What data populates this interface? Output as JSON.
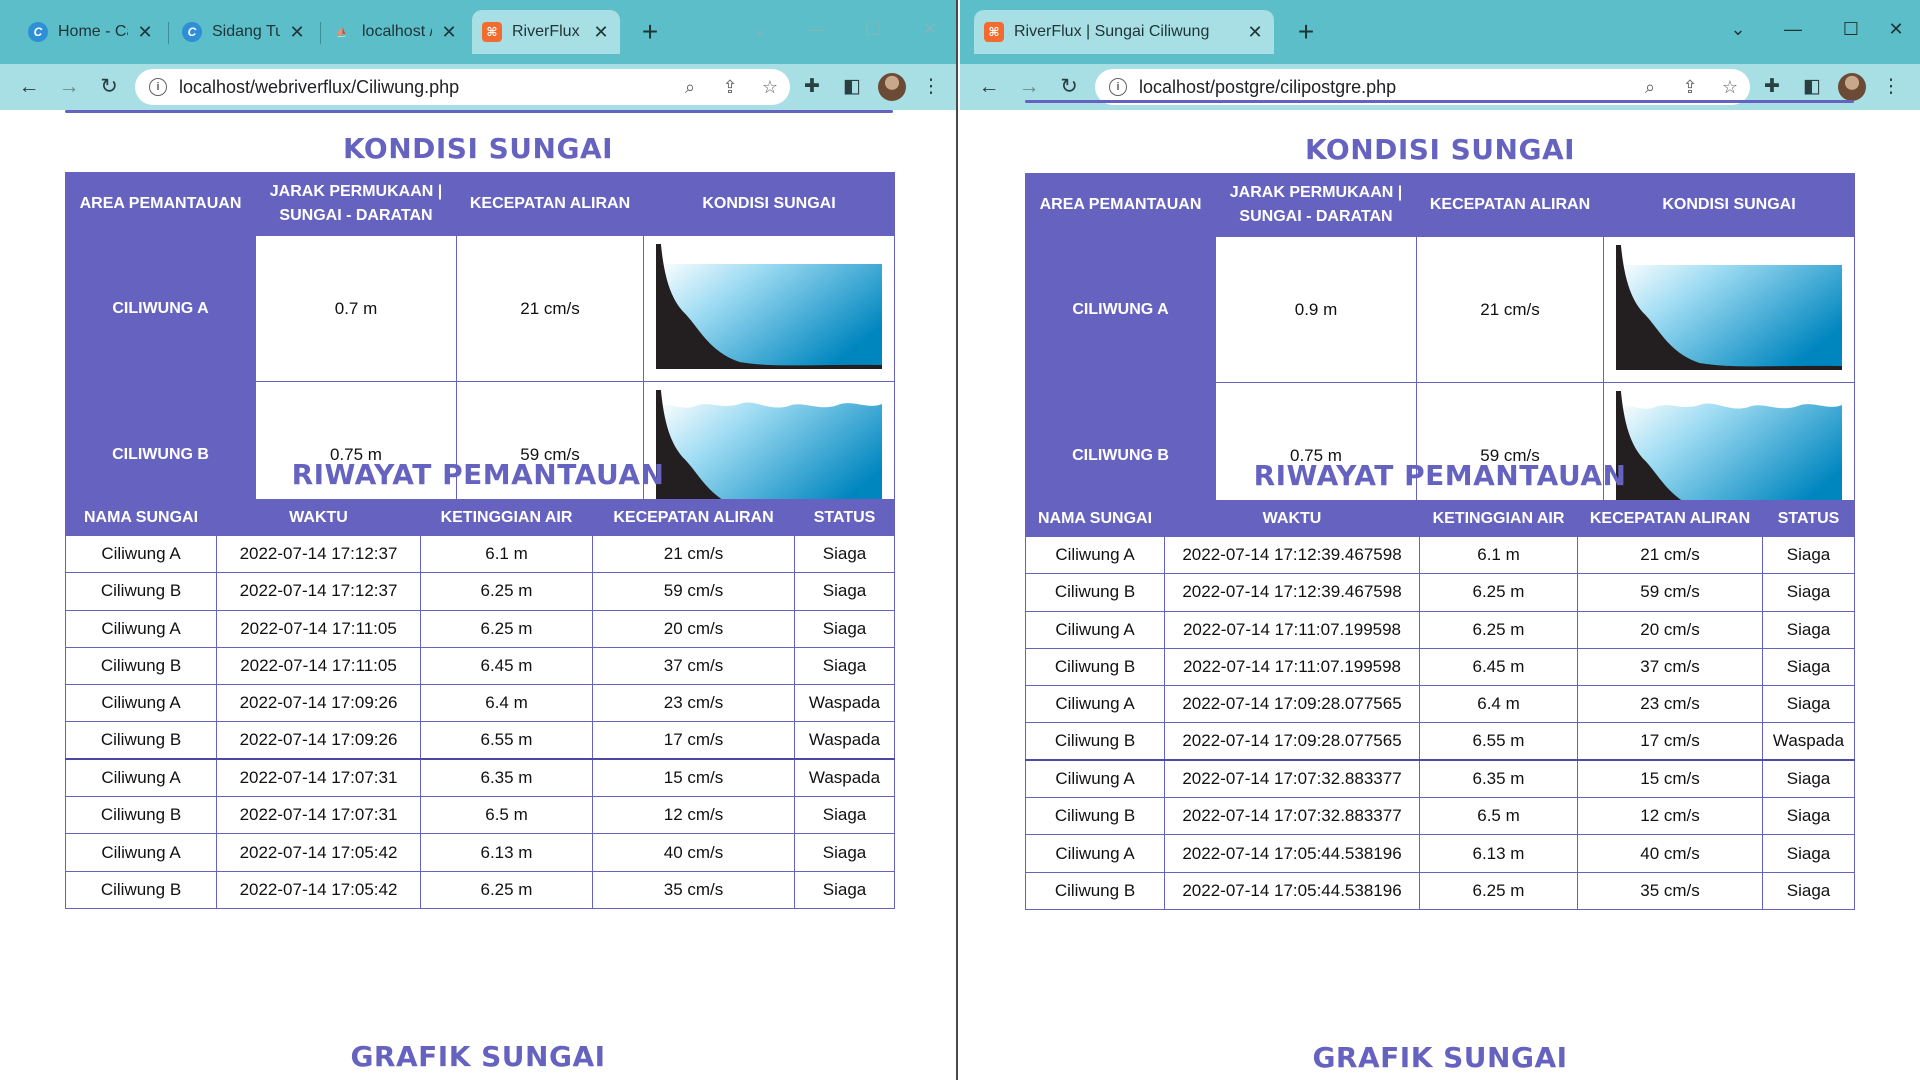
{
  "colors": {
    "accent": "#6563bf",
    "siaga": "#f5a623",
    "waspada": "#e8161b",
    "tab_strip": "#5cbec8",
    "toolbar": "#a7dfe4"
  },
  "left": {
    "tabs": [
      {
        "label": "Home - Ca",
        "icon": "canva-icon"
      },
      {
        "label": "Sidang Tug",
        "icon": "canva-icon"
      },
      {
        "label": "localhost /",
        "icon": "phpmyadmin-icon"
      },
      {
        "label": "RiverFlux |",
        "icon": "xampp-icon"
      }
    ],
    "url": "localhost/webriverflux/Ciliwung.php",
    "kondisi_title": "KONDISI SUNGAI",
    "kondisi_headers": [
      "AREA PEMANTAUAN",
      "JARAK PERMUKAAN | SUNGAI - DARATAN",
      "KECEPATAN ALIRAN",
      "KONDISI SUNGAI"
    ],
    "kondisi_rows": [
      {
        "area": "CILIWUNG A",
        "jarak": "0.7 m",
        "kecepatan": "21 cm/s",
        "kondisi": "calm-water"
      },
      {
        "area": "CILIWUNG B",
        "jarak": "0.75 m",
        "kecepatan": "59 cm/s",
        "kondisi": "wavy-water"
      }
    ],
    "riwayat_title": "RIWAYAT PEMANTAUAN",
    "riwayat_headers": [
      "NAMA SUNGAI",
      "WAKTU",
      "KETINGGIAN AIR",
      "KECEPATAN ALIRAN",
      "STATUS"
    ],
    "riwayat_rows": [
      [
        "Ciliwung A",
        "2022-07-14 17:12:37",
        "6.1 m",
        "21 cm/s",
        "Siaga"
      ],
      [
        "Ciliwung B",
        "2022-07-14 17:12:37",
        "6.25 m",
        "59 cm/s",
        "Siaga"
      ],
      [
        "Ciliwung A",
        "2022-07-14 17:11:05",
        "6.25 m",
        "20 cm/s",
        "Siaga"
      ],
      [
        "Ciliwung B",
        "2022-07-14 17:11:05",
        "6.45 m",
        "37 cm/s",
        "Siaga"
      ],
      [
        "Ciliwung A",
        "2022-07-14 17:09:26",
        "6.4 m",
        "23 cm/s",
        "Waspada"
      ],
      [
        "Ciliwung B",
        "2022-07-14 17:09:26",
        "6.55 m",
        "17 cm/s",
        "Waspada"
      ],
      [
        "Ciliwung A",
        "2022-07-14 17:07:31",
        "6.35 m",
        "15 cm/s",
        "Waspada"
      ],
      [
        "Ciliwung B",
        "2022-07-14 17:07:31",
        "6.5 m",
        "12 cm/s",
        "Siaga"
      ],
      [
        "Ciliwung A",
        "2022-07-14 17:05:42",
        "6.13 m",
        "40 cm/s",
        "Siaga"
      ],
      [
        "Ciliwung B",
        "2022-07-14 17:05:42",
        "6.25 m",
        "35 cm/s",
        "Siaga"
      ]
    ],
    "grafik_title": "GRAFIK SUNGAI"
  },
  "right": {
    "tabs": [
      {
        "label": "RiverFlux | Sungai Ciliwung",
        "icon": "xampp-icon"
      }
    ],
    "url": "localhost/postgre/cilipostgre.php",
    "kondisi_title": "KONDISI SUNGAI",
    "kondisi_headers": [
      "AREA PEMANTAUAN",
      "JARAK PERMUKAAN | SUNGAI - DARATAN",
      "KECEPATAN ALIRAN",
      "KONDISI SUNGAI"
    ],
    "kondisi_rows": [
      {
        "area": "CILIWUNG A",
        "jarak": "0.9 m",
        "kecepatan": "21 cm/s",
        "kondisi": "calm-water"
      },
      {
        "area": "CILIWUNG B",
        "jarak": "0.75 m",
        "kecepatan": "59 cm/s",
        "kondisi": "wavy-water"
      }
    ],
    "riwayat_title": "RIWAYAT PEMANTAUAN",
    "riwayat_headers": [
      "NAMA SUNGAI",
      "WAKTU",
      "KETINGGIAN AIR",
      "KECEPATAN ALIRAN",
      "STATUS"
    ],
    "riwayat_rows": [
      [
        "Ciliwung A",
        "2022-07-14 17:12:39.467598",
        "6.1 m",
        "21 cm/s",
        "Siaga"
      ],
      [
        "Ciliwung B",
        "2022-07-14 17:12:39.467598",
        "6.25 m",
        "59 cm/s",
        "Siaga"
      ],
      [
        "Ciliwung A",
        "2022-07-14 17:11:07.199598",
        "6.25 m",
        "20 cm/s",
        "Siaga"
      ],
      [
        "Ciliwung B",
        "2022-07-14 17:11:07.199598",
        "6.45 m",
        "37 cm/s",
        "Siaga"
      ],
      [
        "Ciliwung A",
        "2022-07-14 17:09:28.077565",
        "6.4 m",
        "23 cm/s",
        "Siaga"
      ],
      [
        "Ciliwung B",
        "2022-07-14 17:09:28.077565",
        "6.55 m",
        "17 cm/s",
        "Waspada"
      ],
      [
        "Ciliwung A",
        "2022-07-14 17:07:32.883377",
        "6.35 m",
        "15 cm/s",
        "Siaga"
      ],
      [
        "Ciliwung B",
        "2022-07-14 17:07:32.883377",
        "6.5 m",
        "12 cm/s",
        "Siaga"
      ],
      [
        "Ciliwung A",
        "2022-07-14 17:05:44.538196",
        "6.13 m",
        "40 cm/s",
        "Siaga"
      ],
      [
        "Ciliwung B",
        "2022-07-14 17:05:44.538196",
        "6.25 m",
        "35 cm/s",
        "Siaga"
      ]
    ],
    "grafik_title": "GRAFIK SUNGAI"
  }
}
